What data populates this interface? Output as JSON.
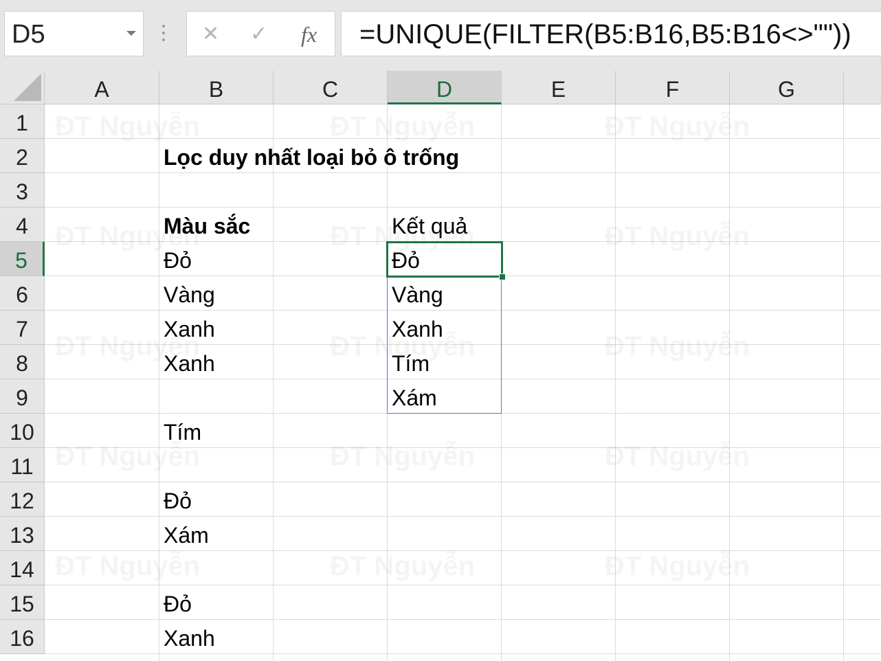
{
  "name_box": {
    "value": "D5"
  },
  "formula_bar": {
    "cancel_glyph": "✕",
    "enter_glyph": "✓",
    "fx_label": "fx",
    "formula": "=UNIQUE(FILTER(B5:B16,B5:B16<>\"\"))"
  },
  "columns": [
    "A",
    "B",
    "C",
    "D",
    "E",
    "F",
    "G"
  ],
  "active_column": "D",
  "rows": [
    "1",
    "2",
    "3",
    "4",
    "5",
    "6",
    "7",
    "8",
    "9",
    "10",
    "11",
    "12",
    "13",
    "14",
    "15",
    "16"
  ],
  "active_row": "5",
  "cells": {
    "B2": "Lọc duy nhất loại bỏ ô trống",
    "B4": "Màu sắc",
    "D4": "Kết quả",
    "B5": "Đỏ",
    "B6": "Vàng",
    "B7": "Xanh",
    "B8": "Xanh",
    "B10": "Tím",
    "B12": "Đỏ",
    "B13": "Xám",
    "B15": "Đỏ",
    "B16": "Xanh",
    "D5": "Đỏ",
    "D6": "Vàng",
    "D7": "Xanh",
    "D8": "Tím",
    "D9": "Xám"
  },
  "watermark": "ĐT Nguyễn",
  "colors": {
    "selection": "#217346",
    "spill_border": "#4a7bd0",
    "header_bg": "#e6e6e6"
  }
}
